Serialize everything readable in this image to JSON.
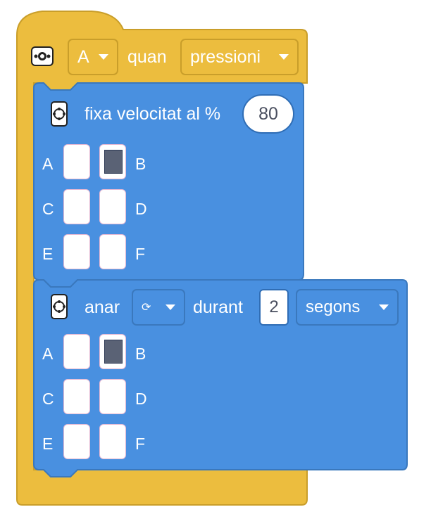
{
  "colors": {
    "event_block": "#ecbd3e",
    "motor_block": "#4990e0",
    "port_active": "#5a6275"
  },
  "event": {
    "icon": "remote-button-icon",
    "button_dropdown": "A",
    "when_label": "quan",
    "action_dropdown": "pressioni"
  },
  "speed_block": {
    "icon": "motor-icon",
    "label": "fixa velocitat al %",
    "value": "80",
    "ports": [
      {
        "left": "A",
        "right": "B",
        "left_on": false,
        "right_on": true
      },
      {
        "left": "C",
        "right": "D",
        "left_on": false,
        "right_on": false
      },
      {
        "left": "E",
        "right": "F",
        "left_on": false,
        "right_on": false
      }
    ]
  },
  "run_block": {
    "icon": "motor-icon",
    "label": "anar",
    "direction_icon": "rotate-clockwise-icon",
    "direction_glyph": "⟳",
    "during_label": "durant",
    "duration": "2",
    "unit_dropdown": "segons",
    "ports": [
      {
        "left": "A",
        "right": "B",
        "left_on": false,
        "right_on": true
      },
      {
        "left": "C",
        "right": "D",
        "left_on": false,
        "right_on": false
      },
      {
        "left": "E",
        "right": "F",
        "left_on": false,
        "right_on": false
      }
    ]
  }
}
